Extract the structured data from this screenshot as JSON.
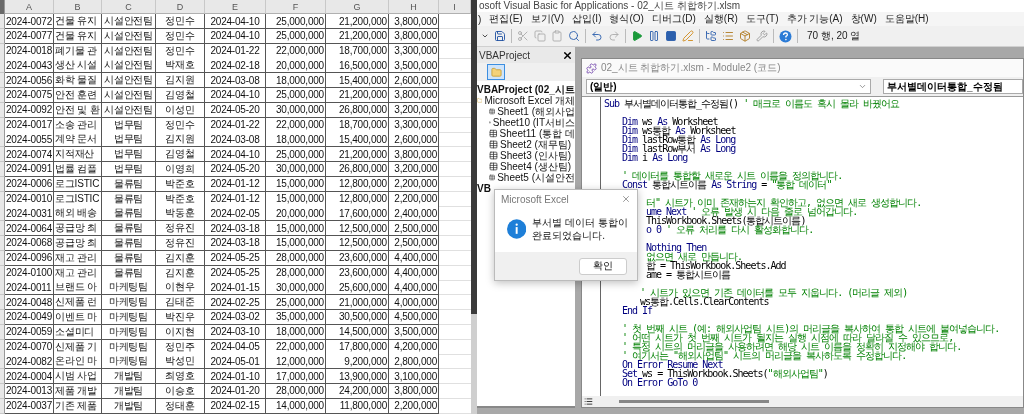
{
  "spreadsheet": {
    "columns": [
      "A",
      "B",
      "C",
      "D",
      "E",
      "F",
      "G",
      "H",
      "I"
    ],
    "rows": [
      [
        "2024-0072",
        "건물 유지",
        "시설안전팀",
        "정민수",
        "2024-04-10",
        "25,000,000",
        "21,200,000",
        "3,800,000"
      ],
      [
        "2024-0077",
        "건물 유지",
        "시설안전팀",
        "정민수",
        "2024-04-10",
        "25,000,000",
        "21,200,000",
        "3,800,000"
      ],
      [
        "2024-0018",
        "폐기물 관",
        "시설안전팀",
        "정민수",
        "2024-01-22",
        "22,000,000",
        "18,700,000",
        "3,300,000"
      ],
      [
        "2024-0043",
        "생산 시설",
        "시설안전팀",
        "박재호",
        "2024-02-18",
        "20,000,000",
        "16,500,000",
        "3,500,000"
      ],
      [
        "2024-0056",
        "화학 물질",
        "시설안전팀",
        "김지원",
        "2024-03-08",
        "18,000,000",
        "15,400,000",
        "2,600,000"
      ],
      [
        "2024-0075",
        "안전 훈련",
        "시설안전팀",
        "김영철",
        "2024-04-10",
        "25,000,000",
        "21,200,000",
        "3,800,000"
      ],
      [
        "2024-0092",
        "안전 및 환",
        "시설안전팀",
        "이성민",
        "2024-05-20",
        "30,000,000",
        "26,800,000",
        "3,200,000"
      ],
      [
        "2024-0017",
        "소송 관리",
        "법무팀",
        "정민수",
        "2024-01-22",
        "22,000,000",
        "18,700,000",
        "3,300,000"
      ],
      [
        "2024-0055",
        "계약 문서",
        "법무팀",
        "김지원",
        "2024-03-08",
        "18,000,000",
        "15,400,000",
        "2,600,000"
      ],
      [
        "2024-0074",
        "지적재산",
        "법무팀",
        "김영철",
        "2024-04-10",
        "25,000,000",
        "21,200,000",
        "3,800,000"
      ],
      [
        "2024-0091",
        "법률 컴플",
        "법무팀",
        "이영희",
        "2024-05-20",
        "30,000,000",
        "26,800,000",
        "3,200,000"
      ],
      [
        "2024-0006",
        "로그ISTIC",
        "물류팀",
        "박준호",
        "2024-01-12",
        "15,000,000",
        "12,800,000",
        "2,200,000"
      ],
      [
        "2024-0010",
        "로그ISTIC",
        "물류팀",
        "박준호",
        "2024-01-12",
        "15,000,000",
        "12,800,000",
        "2,200,000"
      ],
      [
        "2024-0031",
        "해외 배송",
        "물류팀",
        "박동훈",
        "2024-02-05",
        "20,000,000",
        "17,600,000",
        "2,400,000"
      ],
      [
        "2024-0064",
        "공급망 최",
        "물류팀",
        "정유진",
        "2024-03-18",
        "15,000,000",
        "12,500,000",
        "2,500,000"
      ],
      [
        "2024-0068",
        "공급망 최",
        "물류팀",
        "정유진",
        "2024-03-18",
        "15,000,000",
        "12,500,000",
        "2,500,000"
      ],
      [
        "2024-0096",
        "재고 관리",
        "물류팀",
        "김지훈",
        "2024-05-25",
        "28,000,000",
        "23,600,000",
        "4,400,000"
      ],
      [
        "2024-0100",
        "재고 관리",
        "물류팀",
        "김지훈",
        "2024-05-25",
        "28,000,000",
        "23,600,000",
        "4,400,000"
      ],
      [
        "2024-0011",
        "브랜드 아",
        "마케팅팀",
        "이현우",
        "2024-01-15",
        "30,000,000",
        "25,600,000",
        "4,400,000"
      ],
      [
        "2024-0048",
        "신제품 런",
        "마케팅팀",
        "김태준",
        "2024-02-25",
        "25,000,000",
        "21,000,000",
        "4,000,000"
      ],
      [
        "2024-0049",
        "이벤트 마",
        "마케팅팀",
        "박진우",
        "2024-03-02",
        "35,000,000",
        "30,500,000",
        "4,500,000"
      ],
      [
        "2024-0059",
        "소셜미디",
        "마케팅팀",
        "이지현",
        "2024-03-10",
        "18,000,000",
        "14,500,000",
        "3,500,000"
      ],
      [
        "2024-0070",
        "신제품 기",
        "마케팅팀",
        "정민주",
        "2024-04-05",
        "22,000,000",
        "17,800,000",
        "4,200,000"
      ],
      [
        "2024-0082",
        "온라인 마",
        "마케팅팀",
        "박성민",
        "2024-05-01",
        "12,000,000",
        "9,200,000",
        "2,800,000"
      ],
      [
        "2024-0004",
        "시범 사업",
        "개발팀",
        "최영호",
        "2024-01-10",
        "17,000,000",
        "13,900,000",
        "3,100,000"
      ],
      [
        "2024-0013",
        "제품 개발",
        "개발팀",
        "이승호",
        "2024-01-20",
        "28,000,000",
        "24,200,000",
        "3,800,000"
      ],
      [
        "2024-0037",
        "기존 제품",
        "개발팀",
        "정태훈",
        "2024-02-15",
        "14,000,000",
        "11,800,000",
        "2,200,000"
      ]
    ]
  },
  "vba": {
    "title": "osoft Visual Basic for Applications - 02_시트 취합하기.xlsm",
    "menu": [
      ")",
      "편집(E)",
      "보기(V)",
      "삽입(I)",
      "형식(O)",
      "디버그(D)",
      "실행(R)",
      "도구(T)",
      "추가 기능(A)",
      "창(W)",
      "도움말(H)"
    ],
    "cursor_position": "70 행, 20 열",
    "project": {
      "title": "VBAProject",
      "tree": [
        {
          "label": "VBAProject (02_시트",
          "children": [
            {
              "label": "Microsoft Excel 개체",
              "children": [
                {
                  "label": "Sheet1 (해외사업"
                },
                {
                  "label": "Sheet10 (IT서비스"
                },
                {
                  "label": "Sheet11 (통합 데"
                },
                {
                  "label": "Sheet2 (재무팀)"
                },
                {
                  "label": "Sheet3 (인사팀)"
                },
                {
                  "label": "Sheet4 (생산팀)"
                },
                {
                  "label": "Sheet5 (시설안전"
                }
              ]
            }
          ]
        },
        {
          "label": "VB"
        }
      ]
    },
    "code_window": {
      "title": "02_시트 취합하기.xlsm - Module2 (코드)",
      "object": "(일반)",
      "procedure": "부서별데이터통합_수정됨",
      "lines": [
        {
          "kind": "sub",
          "parts": [
            {
              "kind": "kw",
              "text": "Sub"
            },
            {
              "kind": "text",
              "text": " 부서별데이터통합_수정됨() "
            },
            {
              "kind": "comment",
              "text": "' 매크로 이름도 혹시 몰라 바꿨어요"
            }
          ]
        },
        {
          "kind": "gap"
        },
        {
          "kind": "body",
          "parts": [
            {
              "kind": "kw",
              "text": "Dim"
            },
            {
              "kind": "text",
              "text": " ws "
            },
            {
              "kind": "kw",
              "text": "As"
            },
            {
              "kind": "text",
              "text": " Worksheet"
            }
          ]
        },
        {
          "kind": "body",
          "parts": [
            {
              "kind": "kw",
              "text": "Dim"
            },
            {
              "kind": "text",
              "text": " ws통합 "
            },
            {
              "kind": "kw",
              "text": "As"
            },
            {
              "kind": "text",
              "text": " Worksheet"
            }
          ]
        },
        {
          "kind": "body",
          "parts": [
            {
              "kind": "kw",
              "text": "Dim"
            },
            {
              "kind": "text",
              "text": " lastRow통합 "
            },
            {
              "kind": "kw",
              "text": "As Long"
            }
          ]
        },
        {
          "kind": "body",
          "parts": [
            {
              "kind": "kw",
              "text": "Dim"
            },
            {
              "kind": "text",
              "text": " lastRow부서 "
            },
            {
              "kind": "kw",
              "text": "As Long"
            }
          ]
        },
        {
          "kind": "body",
          "parts": [
            {
              "kind": "kw",
              "text": "Dim"
            },
            {
              "kind": "text",
              "text": " i "
            },
            {
              "kind": "kw",
              "text": "As Long"
            }
          ]
        },
        {
          "kind": "gap"
        },
        {
          "kind": "body",
          "parts": [
            {
              "kind": "comment",
              "text": "' 데이터를 통합할 새로운 시트 이름을 정의합니다."
            }
          ]
        },
        {
          "kind": "body",
          "parts": [
            {
              "kind": "kw",
              "text": "Const"
            },
            {
              "kind": "text",
              "text": " 통합시트이름 "
            },
            {
              "kind": "kw",
              "text": "As String"
            },
            {
              "kind": "text",
              "text": " = "
            },
            {
              "kind": "comment",
              "text": "\"통합 데이터\""
            }
          ]
        },
        {
          "kind": "gap"
        },
        {
          "kind": "clip",
          "parts": [
            {
              "kind": "comment",
              "text": "터\" 시트가 이미 존재하는지 확인하고, 없으면 새로 생성합니다."
            }
          ]
        },
        {
          "kind": "clip",
          "parts": [
            {
              "kind": "kw",
              "text": "ume Next"
            },
            {
              "kind": "comment",
              "text": " ' 오류 발생 시 다음 줄로 넘어갑니다."
            }
          ]
        },
        {
          "kind": "clip",
          "parts": [
            {
              "kind": "text",
              "text": "ThisWorkbook.Sheets(통합시트이름)"
            }
          ]
        },
        {
          "kind": "clip",
          "parts": [
            {
              "kind": "kw",
              "text": "o 0"
            },
            {
              "kind": "comment",
              "text": " ' 오류 처리를 다시 활성화합니다."
            }
          ]
        },
        {
          "kind": "gap"
        },
        {
          "kind": "clip",
          "parts": [
            {
              "kind": "kw",
              "text": "Nothing Then"
            }
          ]
        },
        {
          "kind": "clip",
          "parts": [
            {
              "kind": "comment",
              "text": "없으면 새로 만듭니다."
            }
          ]
        },
        {
          "kind": "clip",
          "parts": [
            {
              "kind": "text",
              "text": "합 = ThisWorkbook.Sheets.Add"
            }
          ]
        },
        {
          "kind": "clip",
          "parts": [
            {
              "kind": "text",
              "text": "ame = 통합시트이름"
            }
          ]
        },
        {
          "kind": "gap"
        },
        {
          "kind": "inner",
          "parts": [
            {
              "kind": "comment",
              "text": "' 시트가 있으면 기존 데이터를 모두 지웁니다. (머리글 제외)"
            }
          ]
        },
        {
          "kind": "inner",
          "parts": [
            {
              "kind": "text",
              "text": "ws통합.Cells.ClearContents"
            }
          ]
        },
        {
          "kind": "body",
          "parts": [
            {
              "kind": "kw",
              "text": "End If"
            }
          ]
        },
        {
          "kind": "gap"
        },
        {
          "kind": "body",
          "parts": [
            {
              "kind": "comment",
              "text": "' 첫 번째 시트 (예: 해외사업팀 시트)의 머리글을 복사하여 통합 시트에 붙여넣습니다."
            }
          ]
        },
        {
          "kind": "body",
          "parts": [
            {
              "kind": "comment",
              "text": "' 어떤 시트가 첫 번째 시트가 될지는 실행 시점에 따라 달라질 수 있으므로,"
            }
          ]
        },
        {
          "kind": "body",
          "parts": [
            {
              "kind": "comment",
              "text": "' 특정 시트의 머리글을 사용하려면 해당 시트 이름을 정확히 지정해야 합니다."
            }
          ]
        },
        {
          "kind": "body",
          "parts": [
            {
              "kind": "comment",
              "text": "' 여기서는 \"해외사업팀\" 시트의 머리글을 복사하도록 수정합니다."
            }
          ]
        },
        {
          "kind": "body",
          "parts": [
            {
              "kind": "kw",
              "text": "On Error Resume Next"
            }
          ]
        },
        {
          "kind": "body",
          "parts": [
            {
              "kind": "kw",
              "text": "Set"
            },
            {
              "kind": "text",
              "text": " ws = ThisWorkbook.Sheets("
            },
            {
              "kind": "comment",
              "text": "\"해외사업팀\""
            },
            {
              "kind": "text",
              "text": ")"
            }
          ]
        },
        {
          "kind": "body",
          "parts": [
            {
              "kind": "kw",
              "text": "On Error GoTo 0"
            }
          ]
        }
      ]
    }
  },
  "dialog": {
    "title": "Microsoft Excel",
    "message": "부서별 데이터 통합이 완료되었습니다.",
    "button": "확인"
  }
}
